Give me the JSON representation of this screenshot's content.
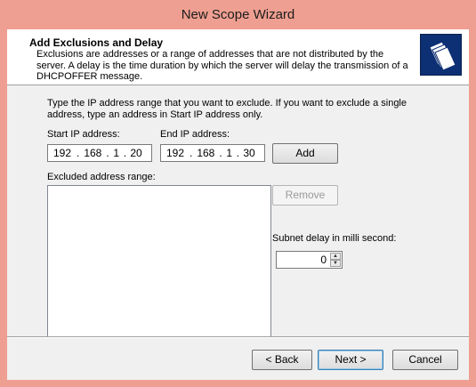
{
  "window": {
    "title": "New Scope Wizard"
  },
  "header": {
    "title": "Add Exclusions and Delay",
    "description": "Exclusions are addresses or a range of addresses that are not distributed by the server. A delay is the time duration by which the server will delay the transmission of a DHCPOFFER message."
  },
  "instructions": "Type the IP address range that you want to exclude. If you want to exclude a single address, type an address in Start IP address only.",
  "start_ip": {
    "label": "Start IP address:",
    "octets": [
      "192",
      "168",
      "1",
      "20"
    ]
  },
  "end_ip": {
    "label": "End IP address:",
    "octets": [
      "192",
      "168",
      "1",
      "30"
    ]
  },
  "add_label": "Add",
  "excluded": {
    "label": "Excluded address range:"
  },
  "remove_label": "Remove",
  "delay": {
    "label": "Subnet delay in milli second:",
    "value": "0"
  },
  "footer": {
    "back": "< Back",
    "next": "Next >",
    "cancel": "Cancel"
  },
  "colors": {
    "frame": "#ef9f91",
    "icon_bg": "#0d2f73"
  },
  "icons": {
    "wizard": "folders-icon"
  }
}
